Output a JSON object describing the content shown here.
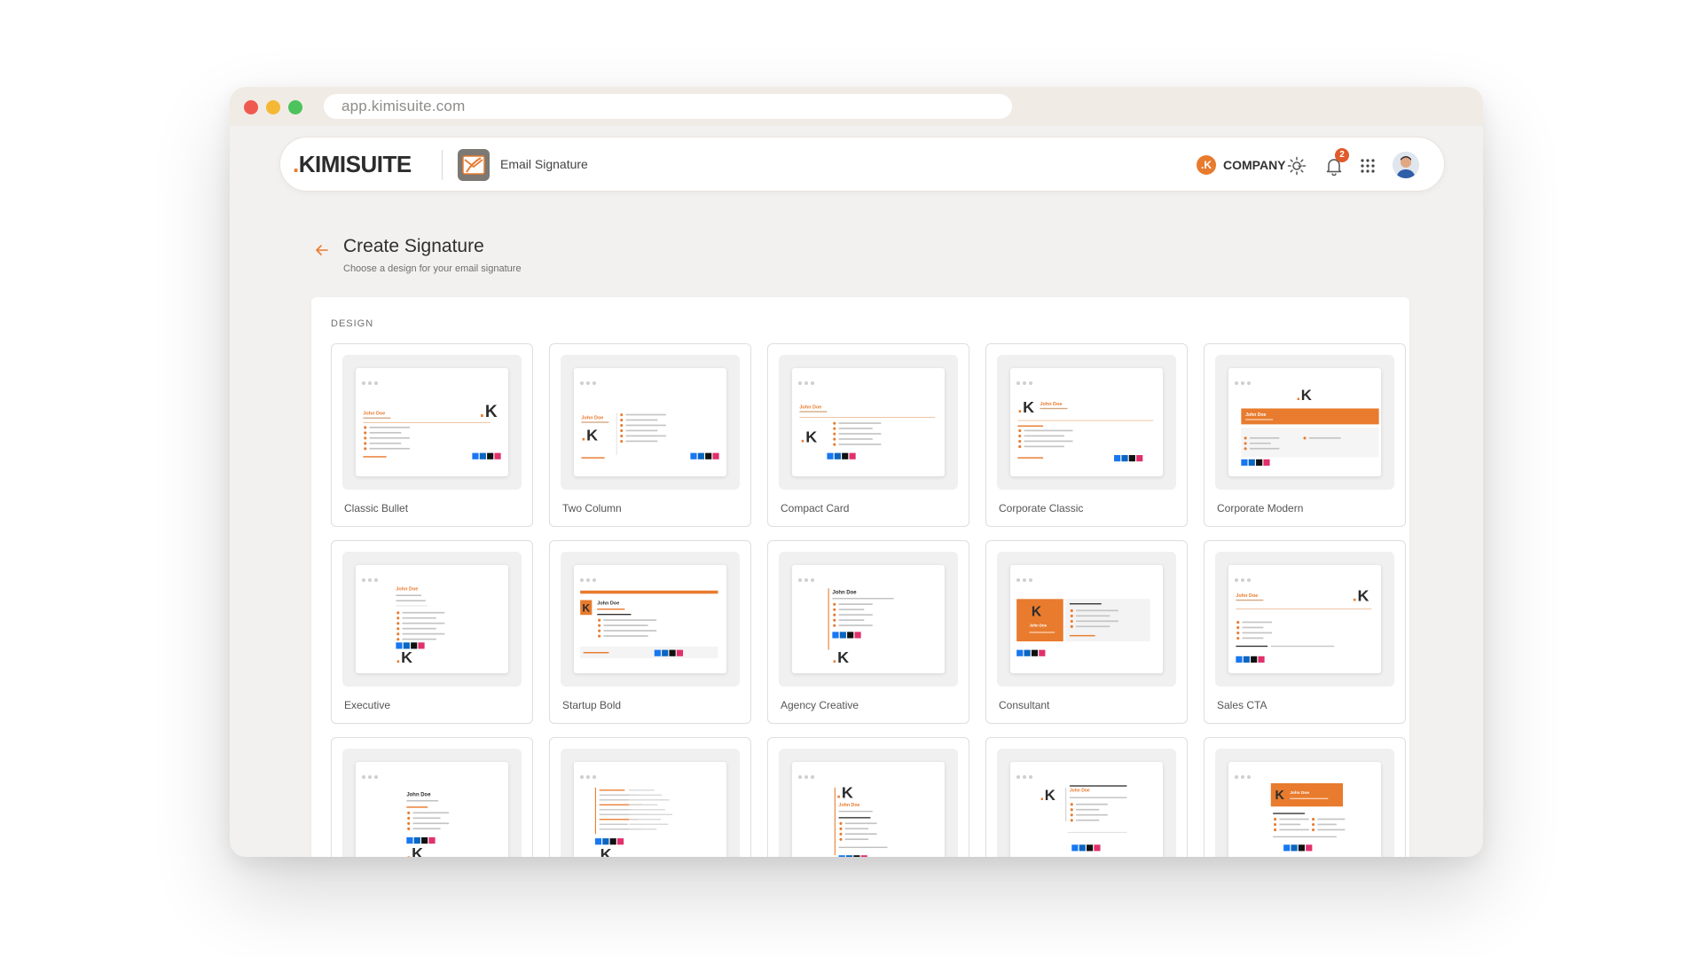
{
  "browser": {
    "url": "app.kimisuite.com"
  },
  "header": {
    "logo_dot": ".",
    "logo_text": "KIMISUITE",
    "app_name": "Email Signature",
    "company_badge": ".K",
    "company_label": "COMPANY",
    "notification_count": "2"
  },
  "page": {
    "title": "Create Signature",
    "subtitle": "Choose a design for your email signature",
    "section_label": "DESIGN"
  },
  "designs": [
    {
      "name": "Classic Bullet",
      "layout": "bullet"
    },
    {
      "name": "Two Column",
      "layout": "twocol"
    },
    {
      "name": "Compact Card",
      "layout": "compact"
    },
    {
      "name": "Corporate Classic",
      "layout": "corpclassic"
    },
    {
      "name": "Corporate Modern",
      "layout": "corpmodern"
    },
    {
      "name": "Executive",
      "layout": "executive"
    },
    {
      "name": "Startup Bold",
      "layout": "startup"
    },
    {
      "name": "Agency Creative",
      "layout": "agency"
    },
    {
      "name": "Consultant",
      "layout": "consultant"
    },
    {
      "name": "Sales CTA",
      "layout": "sales"
    },
    {
      "name": "",
      "layout": "centered"
    },
    {
      "name": "",
      "layout": "monoline"
    },
    {
      "name": "",
      "layout": "vertical"
    },
    {
      "name": "",
      "layout": "boxed"
    },
    {
      "name": "",
      "layout": "banner"
    }
  ],
  "sample": {
    "person": "John Doe"
  },
  "colors": {
    "accent": "#e87b2e",
    "text": "#2f2f2f",
    "muted": "#6e6e6e"
  }
}
